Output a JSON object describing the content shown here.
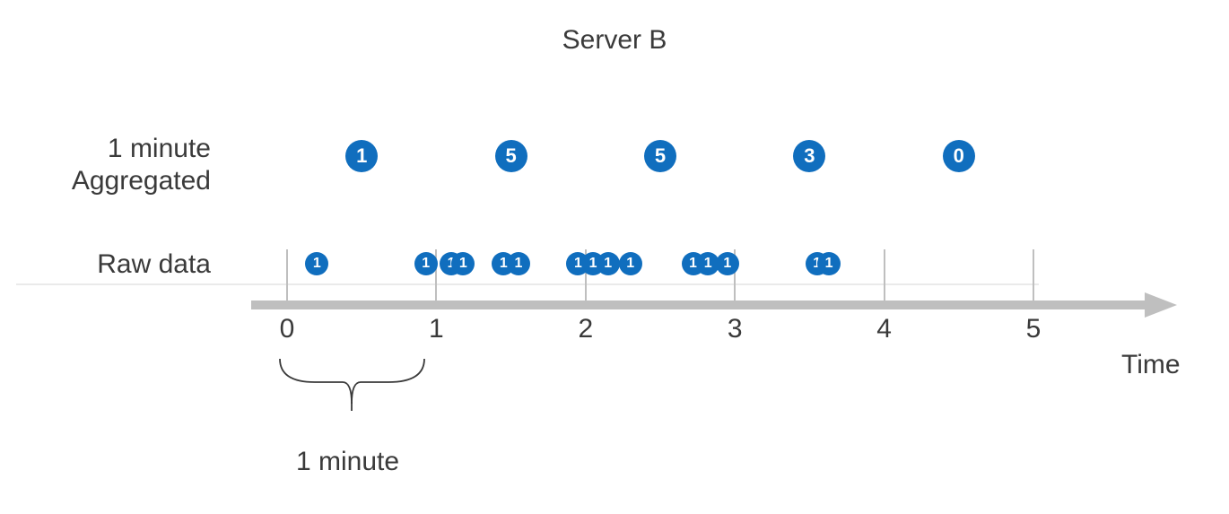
{
  "chart_data": {
    "type": "table",
    "title": "Server B",
    "xlabel": "Time",
    "row_labels": {
      "aggregated": "1 minute\nAggregated",
      "raw": "Raw data"
    },
    "x_ticks": [
      0,
      1,
      2,
      3,
      4,
      5
    ],
    "aggregated": {
      "x": [
        0.5,
        1.5,
        2.5,
        3.5,
        4.5
      ],
      "values": [
        1,
        5,
        5,
        3,
        0
      ]
    },
    "raw": {
      "x": [
        0.2,
        0.93,
        1.1,
        1.18,
        1.45,
        1.55,
        1.95,
        2.05,
        2.15,
        2.3,
        2.72,
        2.82,
        2.95,
        3.55,
        3.63
      ],
      "values": [
        1,
        1,
        1,
        1,
        1,
        1,
        1,
        1,
        1,
        1,
        1,
        1,
        1,
        1,
        1
      ]
    },
    "bracket_label": "1 minute"
  },
  "colors": {
    "dot": "#106ebe",
    "axis": "#bfbfbf",
    "text": "#3a3a3a"
  }
}
